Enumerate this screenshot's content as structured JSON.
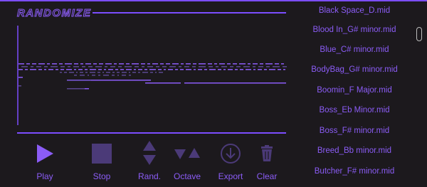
{
  "app": {
    "logo_text": "RANDOMIZE"
  },
  "colors": {
    "accent": "#7c4dff",
    "text_accent": "#8b5cf6",
    "background": "#1c191d",
    "note_dim": "#4b3a78"
  },
  "controls": [
    {
      "label": "Play",
      "icon": "play-icon"
    },
    {
      "label": "Stop",
      "icon": "stop-icon"
    },
    {
      "label": "Rand.",
      "icon": "up-down-arrows-icon"
    },
    {
      "label": "Octave",
      "icon": "octave-arrows-icon"
    },
    {
      "label": "Export",
      "icon": "download-icon"
    },
    {
      "label": "Clear",
      "icon": "trash-icon"
    }
  ],
  "file_list": {
    "items": [
      "Black Space_D.mid",
      "Blood In_G# minor.mid",
      "Blue_C# minor.mid",
      "BodyBag_G# minor.mid",
      "Boomin_F Major.mid",
      "Boss_Eb Minor.mid",
      "Boss_F# minor.mid",
      "Breed_Bb minor.mid",
      "Butcher_F# minor.mid"
    ]
  }
}
